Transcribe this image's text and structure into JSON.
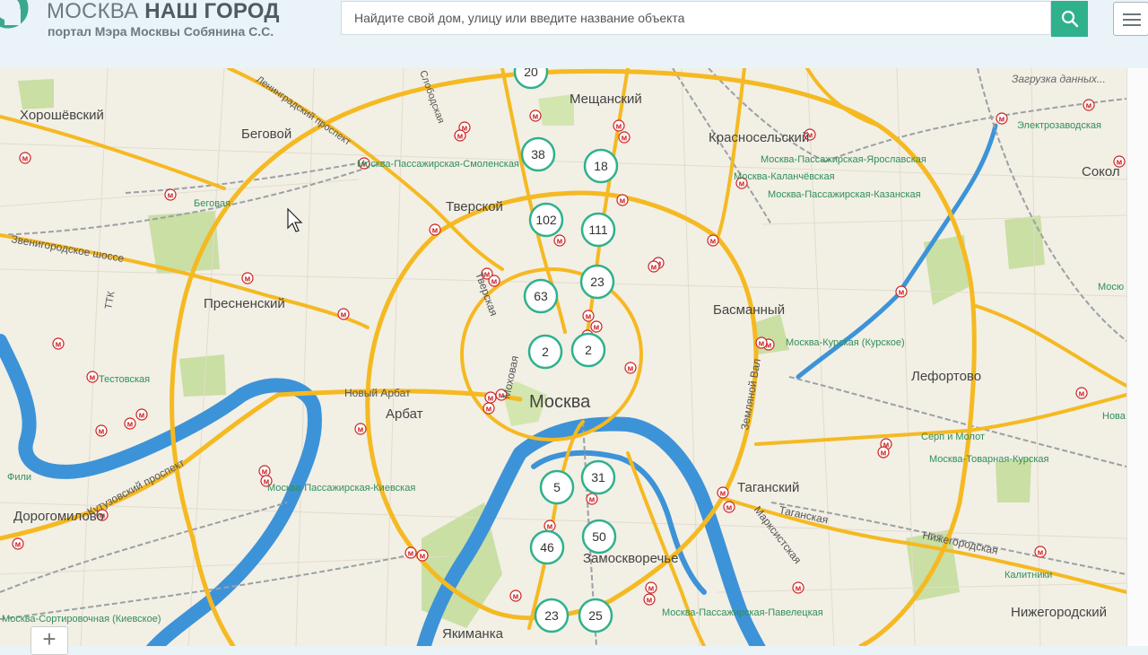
{
  "header": {
    "title_light": "МОСКВА",
    "title_bold": "НАШ ГОРОД",
    "subtitle": "портал Мэра Москвы Собянина С.С.",
    "search_placeholder": "Найдите свой дом, улицу или введите название объекта",
    "search_icon": "search-icon",
    "menu_icon": "hamburger-icon",
    "brand_color": "#2fb18d"
  },
  "map": {
    "loading_text": "Загрузка данных...",
    "zoom_label": "+",
    "colors": {
      "major_road": "#f5b921",
      "river": "#3d93d8",
      "park": "#c9dfa4",
      "railway": "#9aa0a4",
      "metro": "#cc2222",
      "cluster": "#2fb18d"
    },
    "clusters": [
      "20",
      "38",
      "18",
      "102",
      "111",
      "63",
      "23",
      "2",
      "2",
      "5",
      "31",
      "46",
      "50",
      "23",
      "25"
    ],
    "labels": {
      "center": "Москва",
      "districts": [
        "Хорошёвский",
        "Беговой",
        "Мещанский",
        "Красносельский",
        "Сокол",
        "Тверской",
        "Пресненский",
        "Басманный",
        "Лефортово",
        "Арбат",
        "Таганский",
        "Дорогомилово",
        "Замоскворечье",
        "Нижегородский",
        "Якиманка"
      ],
      "stations": [
        "Москва-Пассажирская-Смоленская",
        "Беговая",
        "Москва-Пассажирская-Ярославская",
        "Москва-Каланчёвская",
        "Москва-Пассажирская-Казанская",
        "Электрозаводская",
        "Москва-Курская (Курское)",
        "Тестовская",
        "Москва-Пассажирская-Киевская",
        "Серп и Молот",
        "Москва-Товарная-Курская",
        "Москва-Пассажирская-Павелецкая",
        "Москва-Сортировочная (Киевское)",
        "Калитники",
        "Фили",
        "Мосю",
        "Нова"
      ],
      "streets": [
        "Звенигородское шоссе",
        "Кутузовский проспект",
        "Новый Арбат",
        "Тверская",
        "Моховая",
        "Земляной Вал",
        "Таганская",
        "Марксистская",
        "Нижегородская",
        "Ленинградский проспект",
        "ТТК",
        "Слободская"
      ]
    }
  }
}
